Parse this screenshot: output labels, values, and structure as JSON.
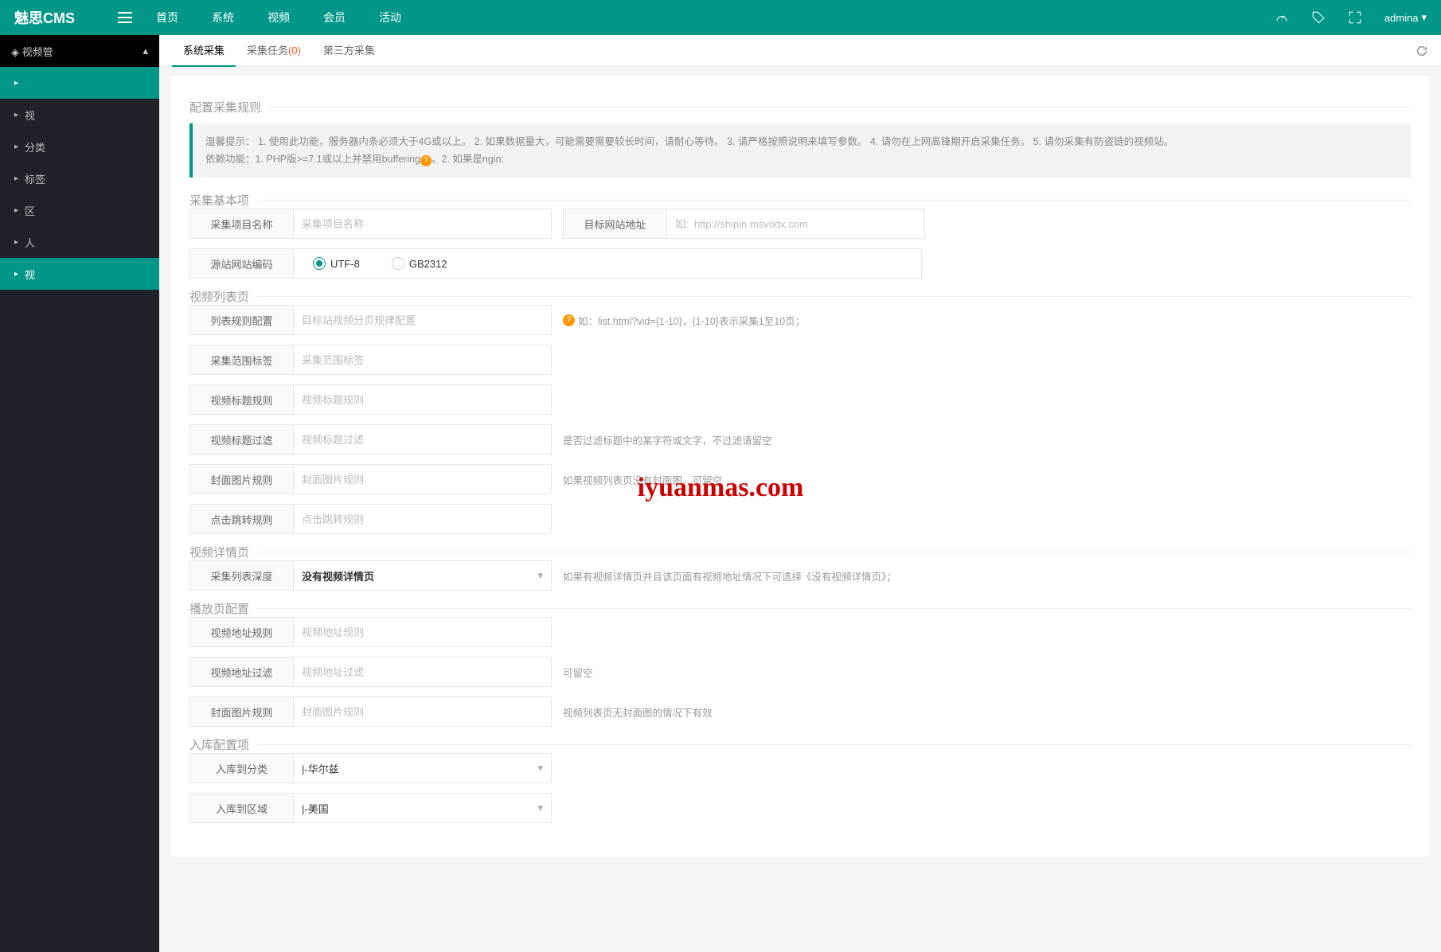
{
  "brand": "魅思CMS",
  "topnav": [
    "首页",
    "系统",
    "视频",
    "会员",
    "活动"
  ],
  "user": "admina",
  "sidebar": {
    "group": "视频管",
    "items": [
      "",
      "视",
      "分类",
      "标签",
      "区",
      "人",
      "视"
    ]
  },
  "tabs": {
    "t1": "系统采集",
    "t2": "采集任务",
    "t2cnt": "(0)",
    "t3": "第三方采集"
  },
  "sections": {
    "s1": "配置采集规则",
    "s2": "采集基本项",
    "s3": "视频列表页",
    "s4": "视频详情页",
    "s5": "播放页配置",
    "s6": "入库配置项"
  },
  "tip": {
    "lead": "温馨提示：",
    "p1": "1.  使用此功能，服务器内条必须大于4G或以上。",
    "p2": "2.  如果数据量大，可能需要需要较长时间，请耐心等待。",
    "p3": "3.  请严格按照说明来填写参数。",
    "p4": "4.  请勿在上网高锋期开启采集任务。",
    "p5": "5.  请勿采集有防盗链的视频站。",
    "dep": "依赖功能：1.  PHP版>=7.1或以上并禁用buffering",
    "dep2": "。2.  如果是ngin:"
  },
  "labels": {
    "projName": "采集项目名称",
    "targetUrl": "目标网站地址",
    "srcEncode": "源站网站编码",
    "listRule": "列表规则配置",
    "rangeTag": "采集范围标签",
    "titleRule": "视频标题规则",
    "titleFilter": "视频标题过滤",
    "coverRule": "封面图片规则",
    "jumpRule": "点击跳转规则",
    "depth": "采集列表深度",
    "vidUrlRule": "视频地址规则",
    "vidUrlFilter": "视频地址过滤",
    "coverRule2": "封面图片规则",
    "storeCate": "入库到分类",
    "storeArea": "入库到区域"
  },
  "placeholders": {
    "projName": "采集项目名称",
    "targetUrl": "如:  http://shipin.msvodx.com",
    "listRule": "目标站视频分页规律配置",
    "rangeTag": "采集范围标签",
    "titleRule": "视频标题规则",
    "titleFilter": "视频标题过滤",
    "coverRule": "封面图片规则",
    "jumpRule": "点击跳转规则",
    "vidUrlRule": "视频地址规则",
    "vidUrlFilter": "视频地址过滤",
    "coverRule2": "封面图片规则"
  },
  "hints": {
    "listRule": "如：list.html?vid={1-10}，{1-10}表示采集1至10页；",
    "titleFilter": "是否过滤标题中的某字符或文字，不过滤请留空",
    "coverRule": "如果视频列表页没有封面图，可留空",
    "depth": "如果有视频详情页并且该页面有视频地址情况下可选择《没有视频详情页》；",
    "vidUrlFilter": "可留空",
    "coverRule2": "视频列表页无封面图的情况下有效"
  },
  "radios": {
    "utf8": "UTF-8",
    "gb": "GB2312"
  },
  "selects": {
    "depth": "没有视频详情页",
    "cate": "|-华尔兹",
    "area": "|-美国"
  },
  "watermark": "iyuanmas.com"
}
